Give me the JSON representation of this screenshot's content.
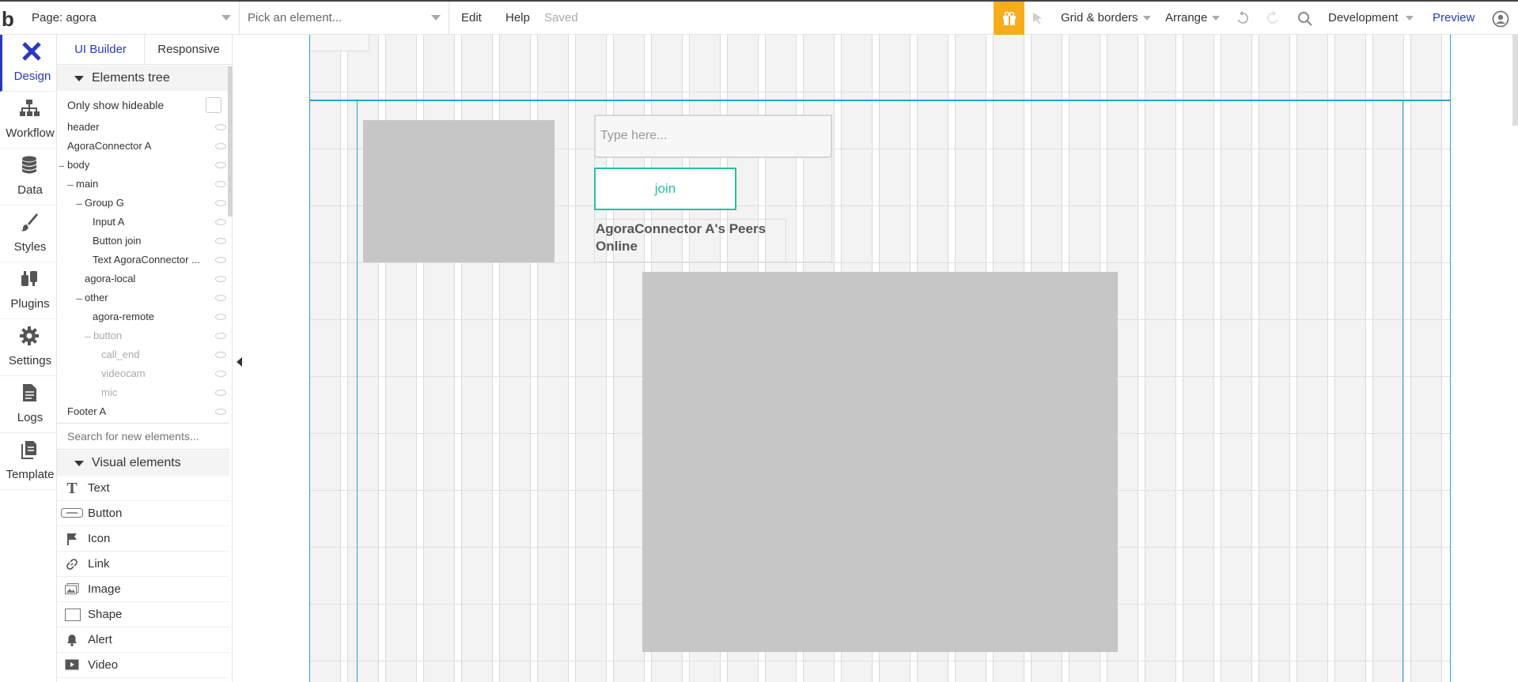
{
  "topbar": {
    "logo": "b",
    "page_select": "Page: agora",
    "element_picker": "Pick an element...",
    "menu": [
      "Edit",
      "Help"
    ],
    "status": "Saved",
    "grid_borders": "Grid & borders",
    "arrange": "Arrange",
    "environment": "Development",
    "preview": "Preview"
  },
  "rail": [
    {
      "label": "Design",
      "icon": "design-icon",
      "active": true
    },
    {
      "label": "Workflow",
      "icon": "workflow-icon"
    },
    {
      "label": "Data",
      "icon": "database-icon"
    },
    {
      "label": "Styles",
      "icon": "brush-icon"
    },
    {
      "label": "Plugins",
      "icon": "plugins-icon"
    },
    {
      "label": "Settings",
      "icon": "gear-icon"
    },
    {
      "label": "Logs",
      "icon": "document-icon"
    },
    {
      "label": "Template",
      "icon": "template-icon"
    }
  ],
  "panel": {
    "tabs": [
      "UI Builder",
      "Responsive"
    ],
    "elements_tree_title": "Elements tree",
    "only_show_hideable": "Only show hideable",
    "tree": [
      {
        "label": "header",
        "level": 0
      },
      {
        "label": "AgoraConnector A",
        "level": 0
      },
      {
        "label": "body",
        "level": 0,
        "expanded": true
      },
      {
        "label": "main",
        "level": 1,
        "expanded": true
      },
      {
        "label": "Group G",
        "level": 2,
        "expanded": true
      },
      {
        "label": "Input A",
        "level": 3
      },
      {
        "label": "Button join",
        "level": 3
      },
      {
        "label": "Text AgoraConnector ...",
        "level": 3
      },
      {
        "label": "agora-local",
        "level": 2
      },
      {
        "label": "other",
        "level": 2,
        "expanded": true
      },
      {
        "label": "agora-remote",
        "level": 3
      },
      {
        "label": "button",
        "level": 3,
        "expanded": true,
        "dim": true
      },
      {
        "label": "call_end",
        "level": 4,
        "dim": true
      },
      {
        "label": "videocam",
        "level": 4,
        "dim": true
      },
      {
        "label": "mic",
        "level": 4,
        "dim": true
      },
      {
        "label": "Footer A",
        "level": 0
      }
    ],
    "search_placeholder": "Search for new elements...",
    "visual_elements_title": "Visual elements",
    "visual_elements": [
      {
        "label": "Text",
        "icon": "text-icon"
      },
      {
        "label": "Button",
        "icon": "button-icon"
      },
      {
        "label": "Icon",
        "icon": "flag-icon"
      },
      {
        "label": "Link",
        "icon": "link-icon"
      },
      {
        "label": "Image",
        "icon": "image-icon"
      },
      {
        "label": "Shape",
        "icon": "shape-icon"
      },
      {
        "label": "Alert",
        "icon": "bell-icon"
      },
      {
        "label": "Video",
        "icon": "video-icon"
      }
    ]
  },
  "canvas": {
    "input_placeholder": "Type here...",
    "join_label": "join",
    "peers_text": "AgoraConnector A's Peers Online"
  },
  "colors": {
    "accent": "#2a39c4",
    "gift": "#f7ad1b",
    "join": "#22c39e",
    "guide": "#2aa3d6",
    "placeholder_box": "#c6c6c6"
  }
}
